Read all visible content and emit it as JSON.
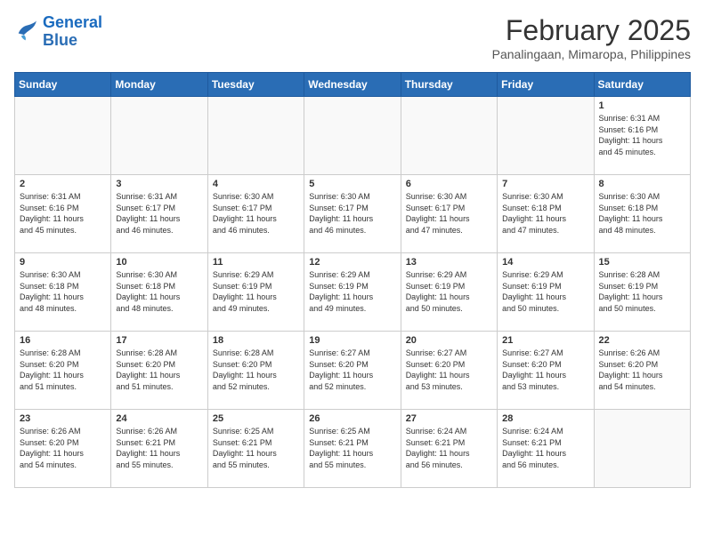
{
  "header": {
    "logo_line1": "General",
    "logo_line2": "Blue",
    "month": "February 2025",
    "location": "Panalingaan, Mimaropa, Philippines"
  },
  "weekdays": [
    "Sunday",
    "Monday",
    "Tuesday",
    "Wednesday",
    "Thursday",
    "Friday",
    "Saturday"
  ],
  "weeks": [
    [
      {
        "day": "",
        "info": ""
      },
      {
        "day": "",
        "info": ""
      },
      {
        "day": "",
        "info": ""
      },
      {
        "day": "",
        "info": ""
      },
      {
        "day": "",
        "info": ""
      },
      {
        "day": "",
        "info": ""
      },
      {
        "day": "1",
        "info": "Sunrise: 6:31 AM\nSunset: 6:16 PM\nDaylight: 11 hours\nand 45 minutes."
      }
    ],
    [
      {
        "day": "2",
        "info": "Sunrise: 6:31 AM\nSunset: 6:16 PM\nDaylight: 11 hours\nand 45 minutes."
      },
      {
        "day": "3",
        "info": "Sunrise: 6:31 AM\nSunset: 6:17 PM\nDaylight: 11 hours\nand 46 minutes."
      },
      {
        "day": "4",
        "info": "Sunrise: 6:30 AM\nSunset: 6:17 PM\nDaylight: 11 hours\nand 46 minutes."
      },
      {
        "day": "5",
        "info": "Sunrise: 6:30 AM\nSunset: 6:17 PM\nDaylight: 11 hours\nand 46 minutes."
      },
      {
        "day": "6",
        "info": "Sunrise: 6:30 AM\nSunset: 6:17 PM\nDaylight: 11 hours\nand 47 minutes."
      },
      {
        "day": "7",
        "info": "Sunrise: 6:30 AM\nSunset: 6:18 PM\nDaylight: 11 hours\nand 47 minutes."
      },
      {
        "day": "8",
        "info": "Sunrise: 6:30 AM\nSunset: 6:18 PM\nDaylight: 11 hours\nand 48 minutes."
      }
    ],
    [
      {
        "day": "9",
        "info": "Sunrise: 6:30 AM\nSunset: 6:18 PM\nDaylight: 11 hours\nand 48 minutes."
      },
      {
        "day": "10",
        "info": "Sunrise: 6:30 AM\nSunset: 6:18 PM\nDaylight: 11 hours\nand 48 minutes."
      },
      {
        "day": "11",
        "info": "Sunrise: 6:29 AM\nSunset: 6:19 PM\nDaylight: 11 hours\nand 49 minutes."
      },
      {
        "day": "12",
        "info": "Sunrise: 6:29 AM\nSunset: 6:19 PM\nDaylight: 11 hours\nand 49 minutes."
      },
      {
        "day": "13",
        "info": "Sunrise: 6:29 AM\nSunset: 6:19 PM\nDaylight: 11 hours\nand 50 minutes."
      },
      {
        "day": "14",
        "info": "Sunrise: 6:29 AM\nSunset: 6:19 PM\nDaylight: 11 hours\nand 50 minutes."
      },
      {
        "day": "15",
        "info": "Sunrise: 6:28 AM\nSunset: 6:19 PM\nDaylight: 11 hours\nand 50 minutes."
      }
    ],
    [
      {
        "day": "16",
        "info": "Sunrise: 6:28 AM\nSunset: 6:20 PM\nDaylight: 11 hours\nand 51 minutes."
      },
      {
        "day": "17",
        "info": "Sunrise: 6:28 AM\nSunset: 6:20 PM\nDaylight: 11 hours\nand 51 minutes."
      },
      {
        "day": "18",
        "info": "Sunrise: 6:28 AM\nSunset: 6:20 PM\nDaylight: 11 hours\nand 52 minutes."
      },
      {
        "day": "19",
        "info": "Sunrise: 6:27 AM\nSunset: 6:20 PM\nDaylight: 11 hours\nand 52 minutes."
      },
      {
        "day": "20",
        "info": "Sunrise: 6:27 AM\nSunset: 6:20 PM\nDaylight: 11 hours\nand 53 minutes."
      },
      {
        "day": "21",
        "info": "Sunrise: 6:27 AM\nSunset: 6:20 PM\nDaylight: 11 hours\nand 53 minutes."
      },
      {
        "day": "22",
        "info": "Sunrise: 6:26 AM\nSunset: 6:20 PM\nDaylight: 11 hours\nand 54 minutes."
      }
    ],
    [
      {
        "day": "23",
        "info": "Sunrise: 6:26 AM\nSunset: 6:20 PM\nDaylight: 11 hours\nand 54 minutes."
      },
      {
        "day": "24",
        "info": "Sunrise: 6:26 AM\nSunset: 6:21 PM\nDaylight: 11 hours\nand 55 minutes."
      },
      {
        "day": "25",
        "info": "Sunrise: 6:25 AM\nSunset: 6:21 PM\nDaylight: 11 hours\nand 55 minutes."
      },
      {
        "day": "26",
        "info": "Sunrise: 6:25 AM\nSunset: 6:21 PM\nDaylight: 11 hours\nand 55 minutes."
      },
      {
        "day": "27",
        "info": "Sunrise: 6:24 AM\nSunset: 6:21 PM\nDaylight: 11 hours\nand 56 minutes."
      },
      {
        "day": "28",
        "info": "Sunrise: 6:24 AM\nSunset: 6:21 PM\nDaylight: 11 hours\nand 56 minutes."
      },
      {
        "day": "",
        "info": ""
      }
    ]
  ]
}
